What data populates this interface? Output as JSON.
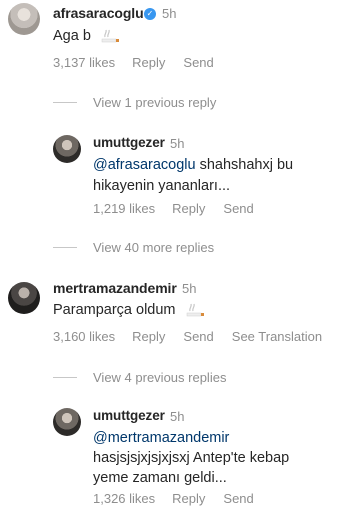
{
  "comments": [
    {
      "username": "afrasaracoglu",
      "time": "5h",
      "text": "Aga b",
      "likes": "3,137 likes",
      "reply": "Reply",
      "send": "Send"
    },
    {
      "username": "umuttgezer",
      "time": "5h",
      "mention": "@afrasaracoglu",
      "text_line1": " shahshahxj bu",
      "text_line2": "hikayenin yananları...",
      "likes": "1,219 likes",
      "reply": "Reply",
      "send": "Send"
    },
    {
      "username": "mertramazandemir",
      "time": "5h",
      "text": "Paramparça oldum",
      "likes": "3,160 likes",
      "reply": "Reply",
      "send": "Send",
      "see_translation": "See Translation"
    },
    {
      "username": "umuttgezer",
      "time": "5h",
      "mention": "@mertramazandemir",
      "text_line1": "hasjsjsjxjsjxjsxj Antep'te kebap",
      "text_line2": "yeme zamanı geldi...",
      "likes": "1,326 likes",
      "reply": "Reply",
      "send": "Send"
    }
  ],
  "view_previous_1": "View 1 previous reply",
  "view_more_40": "View 40 more replies",
  "view_previous_4": "View 4 previous replies",
  "icons": {
    "verified": "verified-badge-icon",
    "emoji": "cigarette-emoji-icon"
  },
  "colors": {
    "verified": "#3897f0",
    "mention": "#00376b",
    "muted": "#8e8e8e"
  }
}
